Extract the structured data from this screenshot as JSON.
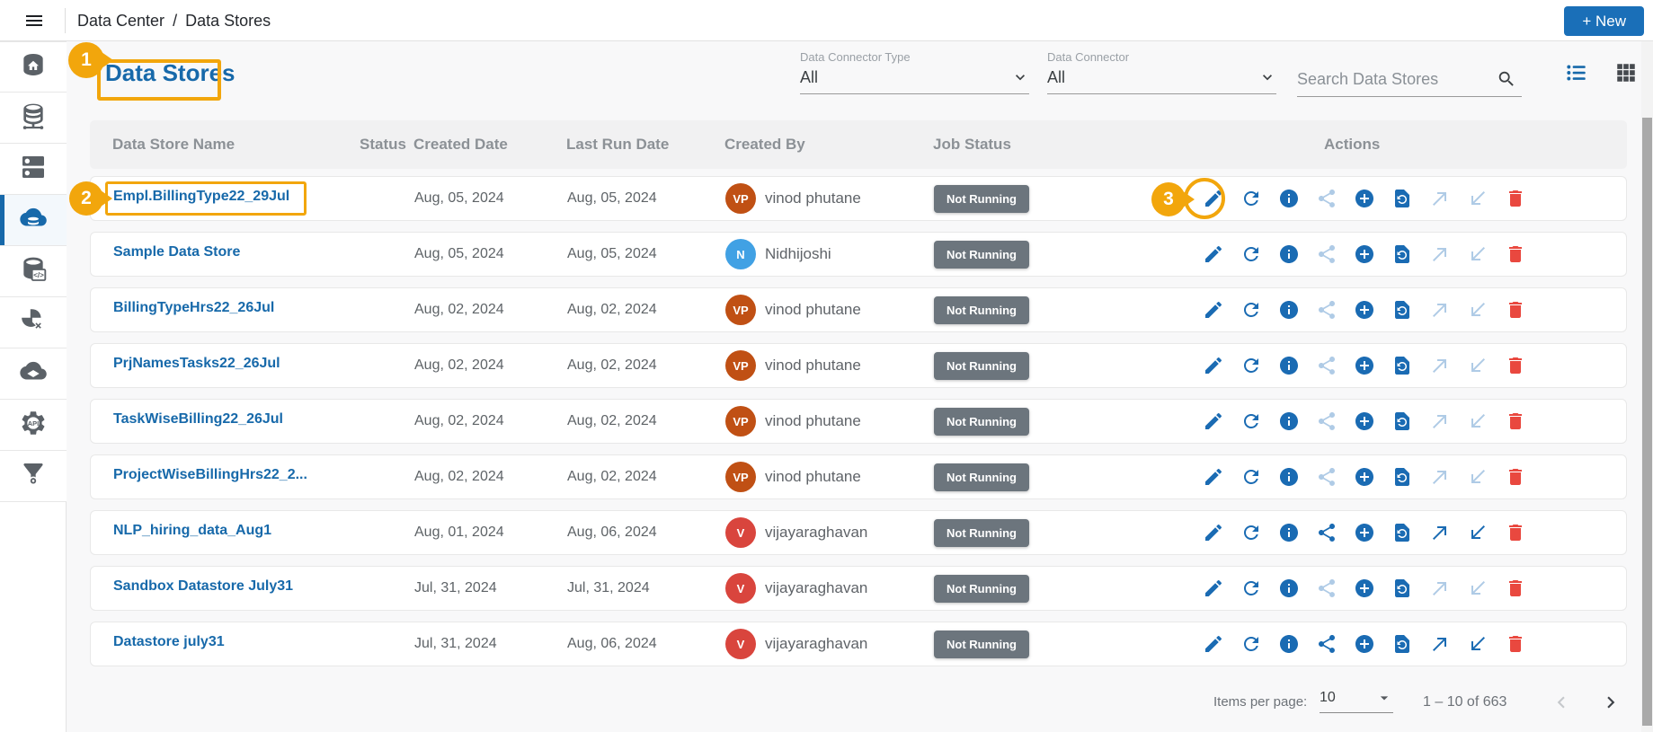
{
  "topbar": {
    "breadcrumb": {
      "section": "Data Center",
      "separator": "/",
      "page": "Data Stores"
    },
    "new_button_label": "+ New"
  },
  "page": {
    "title": "Data Stores"
  },
  "filters": {
    "connector_type": {
      "label": "Data Connector Type",
      "value": "All"
    },
    "connector": {
      "label": "Data Connector",
      "value": "All"
    },
    "search_placeholder": "Search Data Stores"
  },
  "sidebar": {
    "items": [
      {
        "icon": "data-center-icon",
        "active": false
      },
      {
        "icon": "data-sources-icon",
        "active": false
      },
      {
        "icon": "servers-icon",
        "active": false
      },
      {
        "icon": "data-stores-icon",
        "active": true
      },
      {
        "icon": "data-query-icon",
        "active": false
      },
      {
        "icon": "data-transform-icon",
        "active": false
      },
      {
        "icon": "cloud-data-icon",
        "active": false
      },
      {
        "icon": "api-icon",
        "active": false
      },
      {
        "icon": "data-funnel-icon",
        "active": false
      }
    ]
  },
  "table": {
    "columns": [
      "Data Store Name",
      "Status",
      "Created Date",
      "Last Run Date",
      "Created By",
      "Job Status",
      "Actions"
    ],
    "action_icons": [
      "edit-icon",
      "refresh-icon",
      "info-icon",
      "share-icon",
      "add-icon",
      "restore-icon",
      "export-icon",
      "import-icon",
      "delete-icon"
    ],
    "rows": [
      {
        "name": "Empl.BillingType22_29Jul",
        "status": "",
        "created": "Aug, 05, 2024",
        "last_run": "Aug, 05, 2024",
        "creator_initials": "VP",
        "creator_name": "vinod phutane",
        "avatar_color": "#C05014",
        "job_status": "Not Running",
        "share_export_enabled": false
      },
      {
        "name": "Sample Data Store",
        "status": "",
        "created": "Aug, 05, 2024",
        "last_run": "Aug, 05, 2024",
        "creator_initials": "N",
        "creator_name": "Nidhijoshi",
        "avatar_color": "#41A1E4",
        "job_status": "Not Running",
        "share_export_enabled": false
      },
      {
        "name": "BillingTypeHrs22_26Jul",
        "status": "",
        "created": "Aug, 02, 2024",
        "last_run": "Aug, 02, 2024",
        "creator_initials": "VP",
        "creator_name": "vinod phutane",
        "avatar_color": "#C05014",
        "job_status": "Not Running",
        "share_export_enabled": false
      },
      {
        "name": "PrjNamesTasks22_26Jul",
        "status": "",
        "created": "Aug, 02, 2024",
        "last_run": "Aug, 02, 2024",
        "creator_initials": "VP",
        "creator_name": "vinod phutane",
        "avatar_color": "#C05014",
        "job_status": "Not Running",
        "share_export_enabled": false
      },
      {
        "name": "TaskWiseBilling22_26Jul",
        "status": "",
        "created": "Aug, 02, 2024",
        "last_run": "Aug, 02, 2024",
        "creator_initials": "VP",
        "creator_name": "vinod phutane",
        "avatar_color": "#C05014",
        "job_status": "Not Running",
        "share_export_enabled": false
      },
      {
        "name": "ProjectWiseBillingHrs22_2...",
        "status": "",
        "created": "Aug, 02, 2024",
        "last_run": "Aug, 02, 2024",
        "creator_initials": "VP",
        "creator_name": "vinod phutane",
        "avatar_color": "#C05014",
        "job_status": "Not Running",
        "share_export_enabled": false
      },
      {
        "name": "NLP_hiring_data_Aug1",
        "status": "",
        "created": "Aug, 01, 2024",
        "last_run": "Aug, 06, 2024",
        "creator_initials": "V",
        "creator_name": "vijayaraghavan",
        "avatar_color": "#D9453D",
        "job_status": "Not Running",
        "share_export_enabled": true
      },
      {
        "name": "Sandbox Datastore July31",
        "status": "",
        "created": "Jul, 31, 2024",
        "last_run": "Jul, 31, 2024",
        "creator_initials": "V",
        "creator_name": "vijayaraghavan",
        "avatar_color": "#D9453D",
        "job_status": "Not Running",
        "share_export_enabled": false
      },
      {
        "name": "Datastore july31",
        "status": "",
        "created": "Jul, 31, 2024",
        "last_run": "Aug, 06, 2024",
        "creator_initials": "V",
        "creator_name": "vijayaraghavan",
        "avatar_color": "#D9453D",
        "job_status": "Not Running",
        "share_export_enabled": true
      }
    ]
  },
  "footer": {
    "items_per_page_label": "Items per page:",
    "items_per_page_value": "10",
    "range_label": "1 – 10 of 663"
  },
  "annotations": {
    "step1": "1",
    "step2": "2",
    "step3": "3"
  },
  "colors": {
    "accent_blue": "#1769AA",
    "action_blue": "#1A6BB3",
    "action_disabled_blue": "#AFCBE6",
    "delete_red": "#E9483F",
    "job_badge_gray": "#6C757D",
    "annotation_orange": "#F2A60C",
    "new_button_blue": "#1A6FB8"
  }
}
